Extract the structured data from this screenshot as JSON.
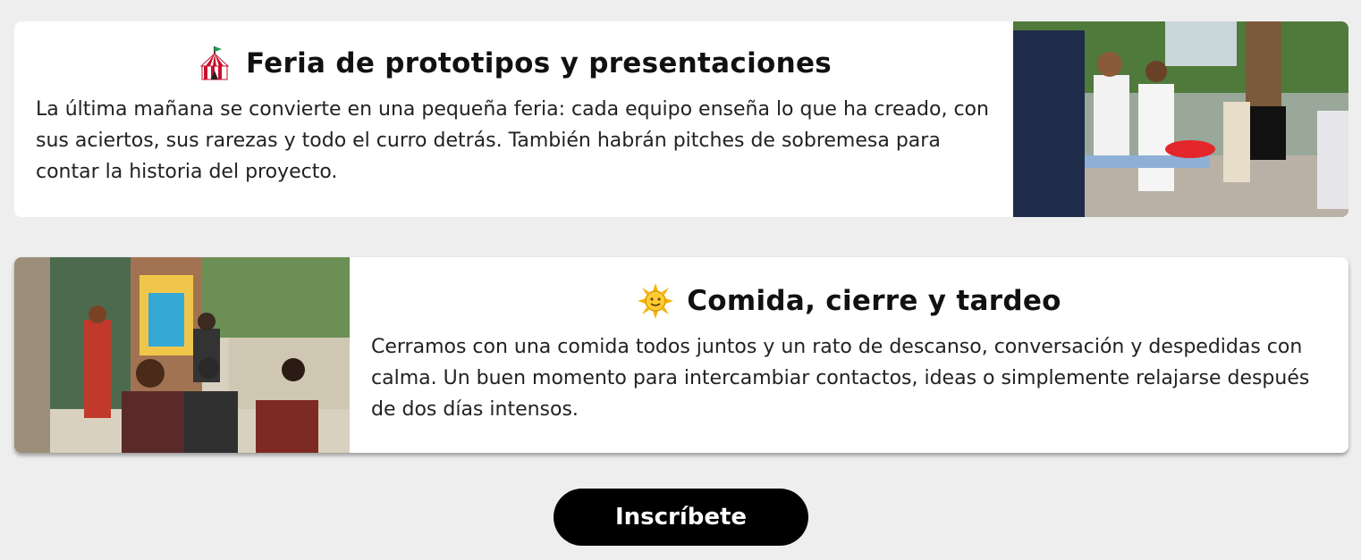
{
  "sections": [
    {
      "icon": "circus-tent-icon",
      "title": "Feria de prototipos y presentaciones",
      "body": "La última mañana se convierte en una pequeña feria: cada equipo enseña lo que ha creado, con sus aciertos, sus rarezas y todo el curro detrás. También habrán pitches de sobremesa para contar la historia del proyecto.",
      "photo": "photo-prototype-fair"
    },
    {
      "icon": "sun-icon",
      "title": "Comida, cierre y tardeo",
      "body": "Cerramos con una comida todos juntos y un rato de descanso, conversación y despedidas con calma. Un buen momento para intercambiar contactos, ideas o simplemente relajarse después de dos días intensos.",
      "photo": "photo-group-circle"
    }
  ],
  "cta": {
    "label": "Inscríbete"
  },
  "colors": {
    "background": "#eeeeee",
    "card": "#ffffff",
    "button": "#000000",
    "button_text": "#ffffff"
  }
}
